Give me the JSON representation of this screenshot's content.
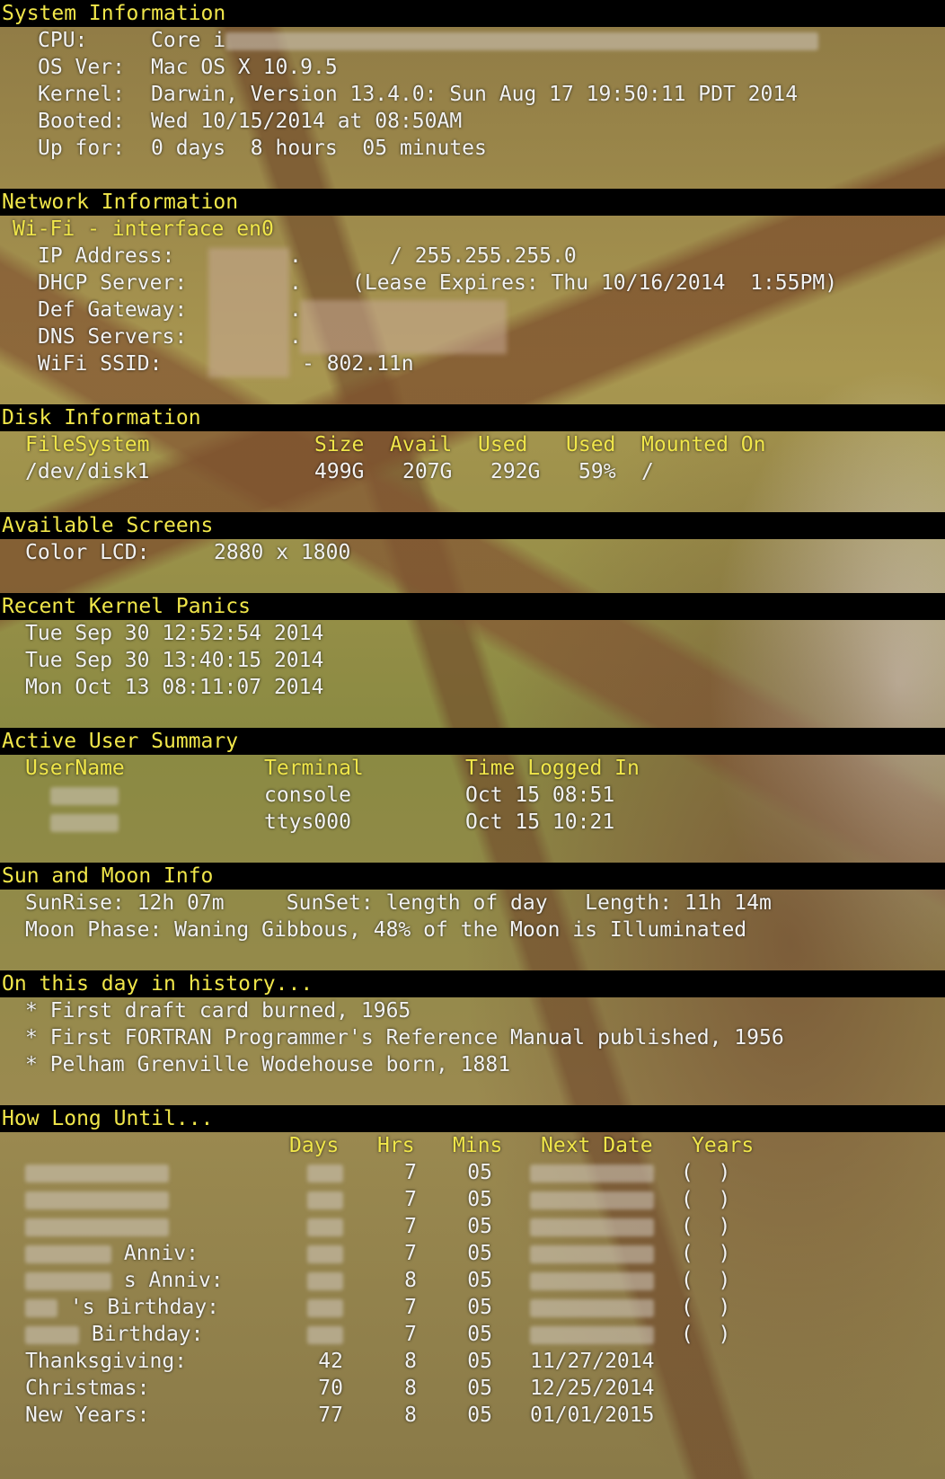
{
  "system": {
    "title": "System Information",
    "cpu_label": "CPU:",
    "cpu_value": "Core i",
    "os_label": "OS Ver:",
    "os_value": "Mac OS X 10.9.5",
    "kernel_label": "Kernel:",
    "kernel_value": "Darwin, Version 13.4.0: Sun Aug 17 19:50:11 PDT 2014",
    "booted_label": "Booted:",
    "booted_value": "Wed 10/15/2014 at 08:50AM",
    "up_label": "Up for:",
    "up_value": "0 days  8 hours  05 minutes"
  },
  "network": {
    "title": "Network Information",
    "interface": "Wi-Fi - interface en0",
    "ip_label": "IP Address:",
    "ip_value": "/ 255.255.255.0",
    "dhcp_label": "DHCP Server:",
    "dhcp_value": "(Lease Expires: Thu 10/16/2014  1:55PM)",
    "gw_label": "Def Gateway:",
    "dns_label": "DNS Servers:",
    "ssid_label": "WiFi SSID:",
    "ssid_value": "- 802.11n"
  },
  "disk": {
    "title": "Disk Information",
    "headers": [
      "FileSystem",
      "Size",
      "Avail",
      "Used",
      "Used",
      "Mounted On"
    ],
    "rows": [
      [
        "/dev/disk1",
        "499G",
        "207G",
        "292G",
        "59%",
        "/"
      ]
    ]
  },
  "screens": {
    "title": "Available Screens",
    "label": "Color LCD:",
    "value": "2880 x 1800"
  },
  "panics": {
    "title": "Recent Kernel Panics",
    "items": [
      "Tue Sep 30 12:52:54 2014",
      "Tue Sep 30 13:40:15 2014",
      "Mon Oct 13 08:11:07 2014"
    ]
  },
  "users": {
    "title": "Active User Summary",
    "headers": [
      "UserName",
      "Terminal",
      "Time Logged In"
    ],
    "rows": [
      [
        "console",
        "Oct 15 08:51"
      ],
      [
        "ttys000",
        "Oct 15 10:21"
      ]
    ]
  },
  "sun": {
    "title": "Sun and Moon Info",
    "line1": "SunRise: 12h 07m     SunSet: length of day   Length: 11h 14m",
    "line2": "Moon Phase: Waning Gibbous, 48% of the Moon is Illuminated"
  },
  "history": {
    "title": "On this day in history...",
    "items": [
      "* First draft card burned, 1965",
      "* First FORTRAN Programmer's Reference Manual published, 1956",
      "* Pelham Grenville Wodehouse born, 1881"
    ]
  },
  "until": {
    "title": "How Long Until...",
    "headers": [
      "Days",
      "Hrs",
      "Mins",
      "Next Date",
      "Years"
    ],
    "rows": [
      {
        "label": "",
        "days": "",
        "hrs": "7",
        "mins": "05",
        "date": "",
        "years": "(  )"
      },
      {
        "label": "",
        "days": "",
        "hrs": "7",
        "mins": "05",
        "date": "",
        "years": "(  )"
      },
      {
        "label": "",
        "days": "",
        "hrs": "7",
        "mins": "05",
        "date": "",
        "years": "(  )"
      },
      {
        "label": "Anniv:",
        "days": "",
        "hrs": "7",
        "mins": "05",
        "date": "",
        "years": "(  )"
      },
      {
        "label": "s Anniv:",
        "days": "",
        "hrs": "8",
        "mins": "05",
        "date": "",
        "years": "(  )"
      },
      {
        "label": "'s Birthday:",
        "days": "",
        "hrs": "7",
        "mins": "05",
        "date": "",
        "years": "(  )"
      },
      {
        "label": "Birthday:",
        "days": "",
        "hrs": "7",
        "mins": "05",
        "date": "",
        "years": "(  )"
      },
      {
        "label": "Thanksgiving:",
        "days": "42",
        "hrs": "8",
        "mins": "05",
        "date": "11/27/2014",
        "years": ""
      },
      {
        "label": "Christmas:",
        "days": "70",
        "hrs": "8",
        "mins": "05",
        "date": "12/25/2014",
        "years": ""
      },
      {
        "label": "New Years:",
        "days": "77",
        "hrs": "8",
        "mins": "05",
        "date": "01/01/2015",
        "years": ""
      }
    ]
  }
}
